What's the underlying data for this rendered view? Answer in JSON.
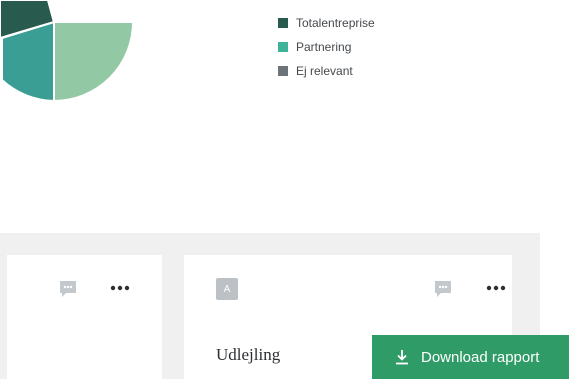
{
  "colors": {
    "dark_teal": "#285a4e",
    "teal": "#3a9e94",
    "light_green": "#92c9a4",
    "accent_green": "#2f9c67",
    "gray_legend": "#6d7479"
  },
  "legend": {
    "items": [
      {
        "label": "Totalentreprise",
        "color": "#285a4e"
      },
      {
        "label": "Partnering",
        "color": "#3fb39a"
      },
      {
        "label": "Ej relevant",
        "color": "#6d7479"
      }
    ]
  },
  "cards": {
    "right": {
      "badge": "A",
      "title": "Udlejling"
    }
  },
  "download_button": {
    "label": "Download rapport",
    "icon": "download-icon"
  }
}
